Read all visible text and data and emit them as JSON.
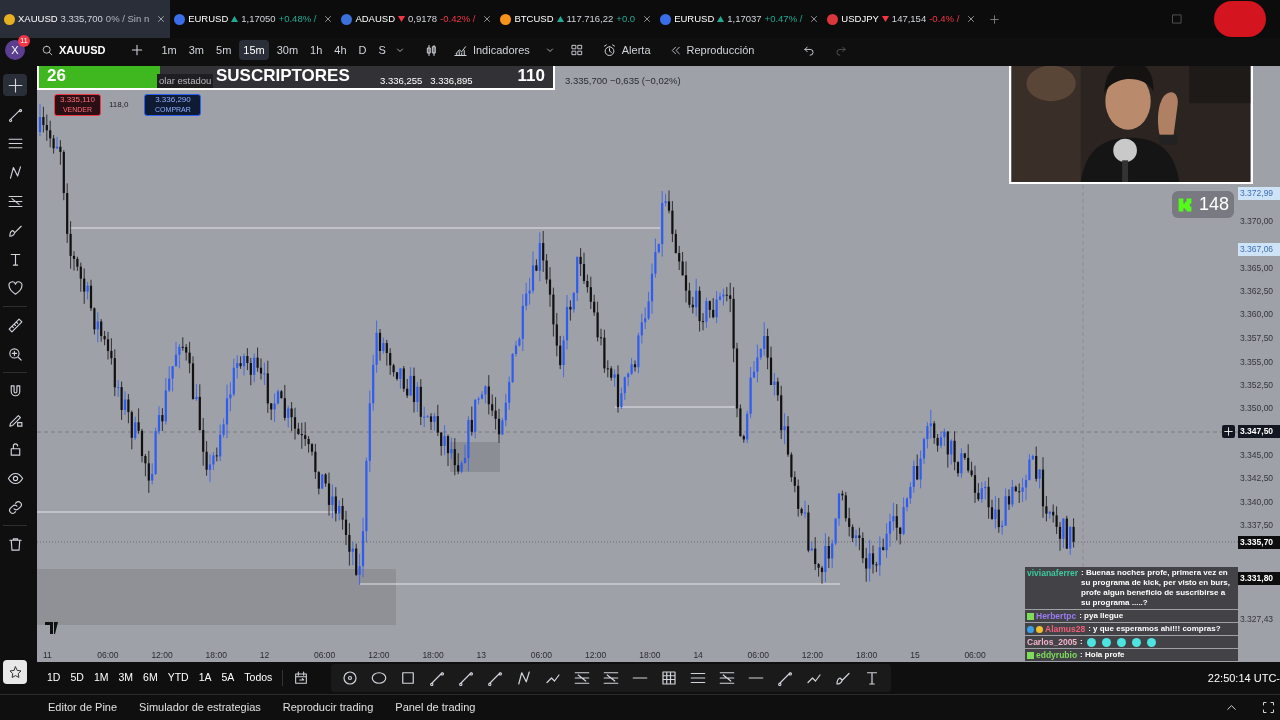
{
  "tabs": [
    {
      "symbol": "XAUUSD",
      "kind": "flat",
      "price": "3.335,700",
      "change": "0% / Sin n",
      "color": "#e8b021",
      "selected": true
    },
    {
      "symbol": "EURUSD",
      "kind": "up",
      "price": "1,17050",
      "change": "+0.48% /",
      "color": "#3a6ee8",
      "selected": false
    },
    {
      "symbol": "ADAUSD",
      "kind": "down",
      "price": "0,9178",
      "change": "-0.42% /",
      "color": "#3b6fd9",
      "selected": false
    },
    {
      "symbol": "BTCUSD",
      "kind": "up",
      "price": "117.716,22",
      "change": "+0.0",
      "color": "#f7931a",
      "selected": false
    },
    {
      "symbol": "EURUSD",
      "kind": "up",
      "price": "1,17037",
      "change": "+0.47% /",
      "color": "#3a6ee8",
      "selected": false
    },
    {
      "symbol": "USDJPY",
      "kind": "down",
      "price": "147,154",
      "change": "-0.4% /",
      "color": "#d9363e",
      "selected": false
    }
  ],
  "toolbar": {
    "avatar": "X",
    "notifications": "11",
    "symbol": "XAUUSD",
    "indicators": "Indicadores",
    "alert": "Alerta",
    "replay": "Reproducción",
    "intervals": [
      {
        "label": "1m",
        "selected": false
      },
      {
        "label": "3m",
        "selected": false
      },
      {
        "label": "5m",
        "selected": false
      },
      {
        "label": "15m",
        "selected": true
      },
      {
        "label": "30m",
        "selected": false
      },
      {
        "label": "1h",
        "selected": false
      },
      {
        "label": "4h",
        "selected": false
      },
      {
        "label": "D",
        "selected": false
      },
      {
        "label": "S",
        "selected": false
      }
    ]
  },
  "subscriber_goal": {
    "count": "26",
    "label": "SUSCRIPTORES",
    "goal": "110",
    "level": 0.236
  },
  "legend": {
    "title": "olar estadou",
    "values": [
      "3.336,255",
      "3.336,895"
    ],
    "last": "3.335,700 −0,635 (−0,02%)"
  },
  "trade": {
    "sell_price": "3.335,110",
    "sell_label": "VENDER",
    "spread": "118,0",
    "buy_price": "3.336,290",
    "buy_label": "COMPRAR"
  },
  "kick": {
    "viewers": "148"
  },
  "price_axis": [
    {
      "label": "3.372,99",
      "kind": "highlight"
    },
    {
      "label": "3.370,00",
      "kind": "tick"
    },
    {
      "label": "3.367,06",
      "kind": "highlight"
    },
    {
      "label": "3.365,00",
      "kind": "tick"
    },
    {
      "label": "3.362,50",
      "kind": "tick"
    },
    {
      "label": "3.360,00",
      "kind": "tick"
    },
    {
      "label": "3.357,50",
      "kind": "tick"
    },
    {
      "label": "3.355,00",
      "kind": "tick"
    },
    {
      "label": "3.352,50",
      "kind": "tick"
    },
    {
      "label": "3.350,00",
      "kind": "tick"
    },
    {
      "label": "3.347,50",
      "kind": "crosshair"
    },
    {
      "label": "3.345,00",
      "kind": "tick"
    },
    {
      "label": "3.342,50",
      "kind": "tick"
    },
    {
      "label": "3.340,00",
      "kind": "tick"
    },
    {
      "label": "3.337,50",
      "kind": "tick"
    },
    {
      "label": "3.335,70",
      "kind": "marker"
    },
    {
      "label": "3.331,80",
      "kind": "marker"
    },
    {
      "label": "3.327,43",
      "kind": "tick"
    }
  ],
  "time_axis": [
    "11",
    "06:00",
    "12:00",
    "18:00",
    "12",
    "06:00",
    "12:00",
    "18:00",
    "13",
    "06:00",
    "12:00",
    "18:00",
    "14",
    "06:00",
    "12:00",
    "18:00",
    "15",
    "06:00"
  ],
  "chat": [
    {
      "user": "vivianaferrer",
      "color": "#3ec9a0",
      "kind": "text",
      "message": ": Buenas noches profe, primera vez en su programa de kick, per visto en burs, profe algun beneficio de suscribirse a su programa .....?"
    },
    {
      "user": "Herbertpc",
      "color": "#9b7bf2",
      "badges": [
        {
          "kind": "plus"
        }
      ],
      "kind": "text",
      "message": ": pya llegue"
    },
    {
      "user": "Alamus28",
      "color": "#f0607a",
      "badges": [
        {
          "kind": "cube"
        },
        {
          "kind": "coin"
        }
      ],
      "kind": "text",
      "message": ": y que esperamos ahi!!! compras?"
    },
    {
      "user": "Carlos_2005",
      "color": "#f3b4c8",
      "kind": "emotes",
      "message": ":",
      "emotes": [
        {
          "kind": "face"
        },
        {
          "kind": "face"
        },
        {
          "kind": "face"
        },
        {
          "kind": "face"
        },
        {
          "kind": "face"
        }
      ]
    },
    {
      "user": "eddyrubio",
      "color": "#7ddc5a",
      "badges": [
        {
          "kind": "plus"
        }
      ],
      "kind": "text",
      "message": ": Hola profe"
    }
  ],
  "ranges": [
    "1D",
    "5D",
    "1M",
    "3M",
    "6M",
    "YTD",
    "1A",
    "5A",
    "Todos"
  ],
  "clock": "22:50:14 UTC-",
  "bottom_tabs": [
    "Editor de Pine",
    "Simulador de estrategias",
    "Reproducir trading",
    "Panel de trading"
  ]
}
